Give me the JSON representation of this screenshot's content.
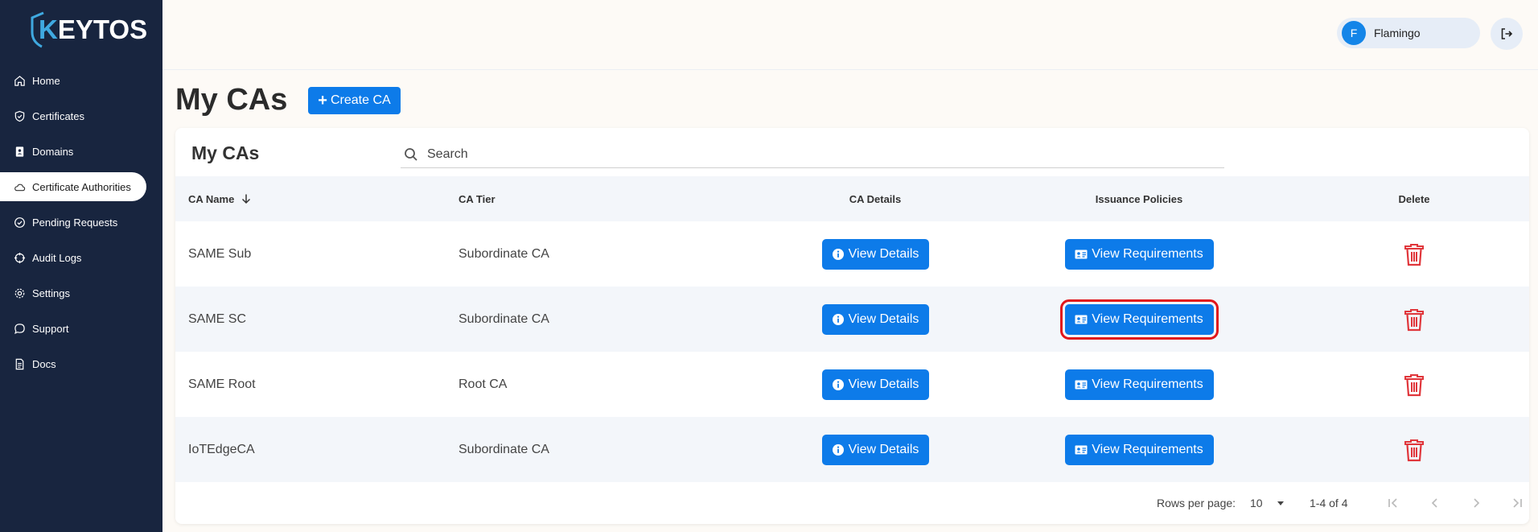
{
  "brand": {
    "logo_k": "K",
    "logo_rest": "EYTOS"
  },
  "sidebar": {
    "items": [
      {
        "label": "Home",
        "icon": "home-icon"
      },
      {
        "label": "Certificates",
        "icon": "shield-check-icon"
      },
      {
        "label": "Domains",
        "icon": "contact-card-icon"
      },
      {
        "label": "Certificate Authorities",
        "icon": "cloud-icon",
        "active": true
      },
      {
        "label": "Pending Requests",
        "icon": "check-circle-icon"
      },
      {
        "label": "Audit Logs",
        "icon": "crosshair-icon"
      },
      {
        "label": "Settings",
        "icon": "gear-icon"
      },
      {
        "label": "Support",
        "icon": "chat-bubble-icon"
      },
      {
        "label": "Docs",
        "icon": "document-icon"
      }
    ]
  },
  "user": {
    "initial": "F",
    "name": "Flamingo"
  },
  "header": {
    "title": "My CAs",
    "create_label": "Create CA"
  },
  "card": {
    "title": "My CAs",
    "search_placeholder": "Search"
  },
  "table": {
    "columns": {
      "name": "CA Name",
      "tier": "CA Tier",
      "details": "CA Details",
      "policies": "Issuance Policies",
      "delete": "Delete"
    },
    "details_label": "View Details",
    "requirements_label": "View Requirements",
    "rows": [
      {
        "name": "SAME Sub",
        "tier": "Subordinate CA"
      },
      {
        "name": "SAME SC",
        "tier": "Subordinate CA",
        "highlighted": true
      },
      {
        "name": "SAME Root",
        "tier": "Root CA"
      },
      {
        "name": "IoTEdgeCA",
        "tier": "Subordinate CA"
      }
    ]
  },
  "pagination": {
    "rows_per_page_label": "Rows per page:",
    "rows_per_page": "10",
    "range": "1-4 of 4"
  },
  "colors": {
    "sidebar": "#18253f",
    "accent": "#0d7be9",
    "delete": "#e0363b",
    "highlight": "#e0161b"
  }
}
